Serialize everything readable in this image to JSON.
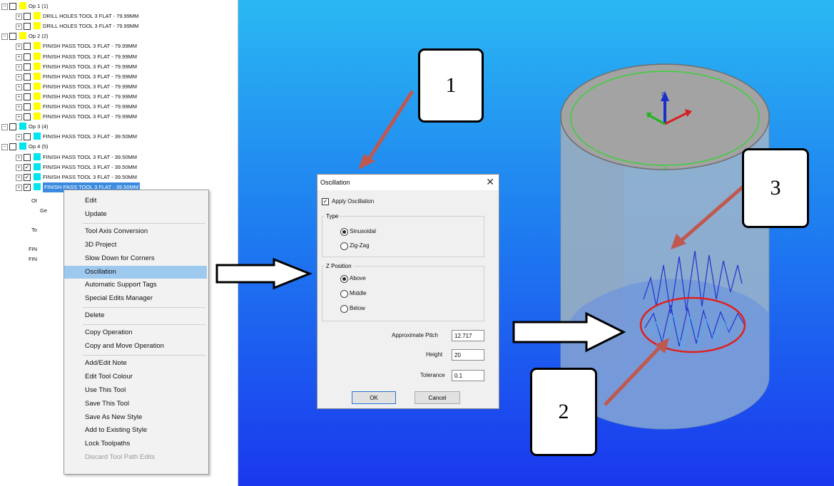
{
  "tree": {
    "rows": [
      {
        "text": "Op 1  (1)",
        "kind": "group",
        "swatch": "yellow"
      },
      {
        "text": "DRILL HOLES  TOOL 3  FLAT - 79.99MM",
        "kind": "item",
        "swatch": "yellow"
      },
      {
        "text": "DRILL HOLES  TOOL 3  FLAT - 79.99MM",
        "kind": "item",
        "swatch": "yellow"
      },
      {
        "text": "Op 2  (2)",
        "kind": "group",
        "swatch": "yellow"
      },
      {
        "text": "FINISH PASS  TOOL 3  FLAT - 79.99MM",
        "kind": "item",
        "swatch": "yellow"
      },
      {
        "text": "FINISH PASS  TOOL 3  FLAT - 79.99MM",
        "kind": "item",
        "swatch": "yellow"
      },
      {
        "text": "FINISH PASS  TOOL 3  FLAT - 79.99MM",
        "kind": "item",
        "swatch": "yellow"
      },
      {
        "text": "FINISH PASS  TOOL 3  FLAT - 79.99MM",
        "kind": "item",
        "swatch": "yellow"
      },
      {
        "text": "FINISH PASS  TOOL 3  FLAT - 79.99MM",
        "kind": "item",
        "swatch": "yellow"
      },
      {
        "text": "FINISH PASS  TOOL 3  FLAT - 79.99MM",
        "kind": "item",
        "swatch": "yellow"
      },
      {
        "text": "FINISH PASS  TOOL 3  FLAT - 79.99MM",
        "kind": "item",
        "swatch": "yellow"
      },
      {
        "text": "FINISH PASS  TOOL 3  FLAT - 79.99MM",
        "kind": "item",
        "swatch": "yellow"
      },
      {
        "text": "Op 3  (4)",
        "kind": "group",
        "swatch": "cyan"
      },
      {
        "text": "FINISH PASS  TOOL 3  FLAT - 39.50MM",
        "kind": "item",
        "swatch": "cyan"
      },
      {
        "text": "Op 4  (5)",
        "kind": "group",
        "swatch": "cyan"
      },
      {
        "text": "FINISH PASS  TOOL 3  FLAT - 39.50MM",
        "kind": "item",
        "swatch": "cyan"
      },
      {
        "text": "FINISH PASS  TOOL 3  FLAT - 39.50MM",
        "kind": "item",
        "swatch": "cyan",
        "checked": true
      },
      {
        "text": "FINISH PASS  TOOL 3  FLAT - 39.50MM",
        "kind": "item",
        "swatch": "cyan",
        "checked": true
      },
      {
        "text": "FINISH PASS  TOOL 3  FLAT - 39.50MM",
        "kind": "item",
        "swatch": "cyan",
        "checked": true,
        "selected": true
      }
    ],
    "partial": [
      "Ot",
      "Ge",
      "To",
      "FIN",
      "FIN"
    ]
  },
  "menu": {
    "items": [
      {
        "label": "Edit"
      },
      {
        "label": "Update"
      },
      {
        "sep": true
      },
      {
        "label": "Tool Axis Conversion"
      },
      {
        "label": "3D Project"
      },
      {
        "label": "Slow Down for Corners"
      },
      {
        "label": "Oscillation",
        "highlighted": true
      },
      {
        "label": "Automatic Support Tags"
      },
      {
        "label": "Special Edits Manager"
      },
      {
        "sep": true
      },
      {
        "label": "Delete"
      },
      {
        "sep": true
      },
      {
        "label": "Copy Operation"
      },
      {
        "label": "Copy and Move Operation"
      },
      {
        "sep": true
      },
      {
        "label": "Add/Edit Note"
      },
      {
        "label": "Edit Tool Colour"
      },
      {
        "label": "Use This Tool"
      },
      {
        "label": "Save This Tool"
      },
      {
        "label": "Save As New Style"
      },
      {
        "label": "Add to Existing Style"
      },
      {
        "label": "Lock Toolpaths"
      },
      {
        "label": "Discard Tool Path Edits",
        "disabled": true
      }
    ]
  },
  "dialog": {
    "title": "Oscillation",
    "close": "✕",
    "apply_label": "Apply Oscillation",
    "type_group": "Type",
    "type_options": [
      "Sinusoidal",
      "Zig-Zag"
    ],
    "z_group": "Z Position",
    "z_options": [
      "Above",
      "Middle",
      "Below"
    ],
    "pitch_label": "Approximate Pitch",
    "pitch_value": "12.717",
    "height_label": "Height",
    "height_value": "20",
    "tolerance_label": "Tolerance",
    "tolerance_value": "0.1",
    "ok": "OK",
    "cancel": "Cancel"
  },
  "callouts": {
    "one": "1",
    "two": "2",
    "three": "3"
  },
  "colors": {
    "viewport_top": "#2ab8f2",
    "viewport_bottom": "#1a38ee",
    "highlight": "#9ec9ef",
    "arrow": "#c0584f",
    "ellipse": "#e0201c"
  }
}
